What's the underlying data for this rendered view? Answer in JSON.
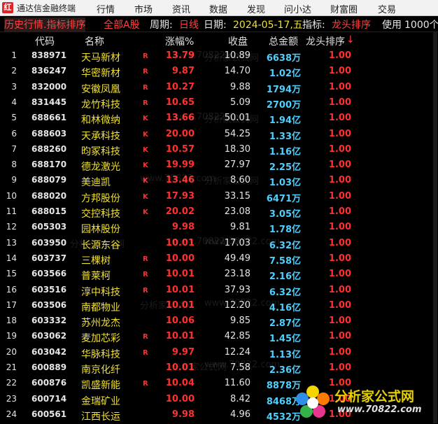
{
  "window": {
    "app_title": "通达信金融终端",
    "icon_glyph": "红"
  },
  "menus": [
    "行情",
    "市场",
    "资讯",
    "数据",
    "发现",
    "问小达",
    "财富圈",
    "交易"
  ],
  "infobar": {
    "part1": "历史行情.指标排序",
    "part2": "全部A股",
    "period_label": "周期:",
    "period_value": "日线",
    "date_label": "日期:",
    "date_value": "2024-05-17,五",
    "indicator_label": "指标:",
    "indicator_value": "龙头排序",
    "usage_label": "使用",
    "usage_value": "1000个"
  },
  "columns": {
    "code": "代码",
    "name": "名称",
    "pct": "涨幅%",
    "close": "收盘",
    "amount": "总金额",
    "rank": "龙头排序",
    "sort_arrow": "↓"
  },
  "colors": {
    "up": "#ff3030",
    "flat": "#e6e6e6",
    "name": "#f0e030",
    "amount": "#4ed0ff"
  },
  "rows": [
    {
      "idx": "1",
      "code": "838971",
      "name": "天马新材",
      "flag": "R",
      "pct": "13.79",
      "close": "10.89",
      "amount": "6638万",
      "rank": "1.00"
    },
    {
      "idx": "2",
      "code": "836247",
      "name": "华密新材",
      "flag": "R",
      "pct": "9.87",
      "close": "14.70",
      "amount": "1.02亿",
      "rank": "1.00"
    },
    {
      "idx": "3",
      "code": "832000",
      "name": "安徽凤凰",
      "flag": "R",
      "pct": "10.27",
      "close": "9.88",
      "amount": "1794万",
      "rank": "1.00"
    },
    {
      "idx": "4",
      "code": "831445",
      "name": "龙竹科技",
      "flag": "R",
      "pct": "10.65",
      "close": "5.09",
      "amount": "2700万",
      "rank": "1.00"
    },
    {
      "idx": "5",
      "code": "688661",
      "name": "和林微纳",
      "flag": "K",
      "pct": "13.66",
      "close": "50.01",
      "amount": "1.94亿",
      "rank": "1.00"
    },
    {
      "idx": "6",
      "code": "688603",
      "name": "天承科技",
      "flag": "K",
      "pct": "20.00",
      "close": "54.25",
      "amount": "1.33亿",
      "rank": "1.00"
    },
    {
      "idx": "7",
      "code": "688260",
      "name": "昀冢科技",
      "flag": "K",
      "pct": "10.57",
      "close": "18.30",
      "amount": "1.16亿",
      "rank": "1.00"
    },
    {
      "idx": "8",
      "code": "688170",
      "name": "德龙激光",
      "flag": "K",
      "pct": "19.99",
      "close": "27.97",
      "amount": "2.25亿",
      "rank": "1.00"
    },
    {
      "idx": "9",
      "code": "688079",
      "name": "美迪凯",
      "flag": "K",
      "pct": "13.46",
      "close": "8.60",
      "amount": "1.03亿",
      "rank": "1.00"
    },
    {
      "idx": "10",
      "code": "688020",
      "name": "方邦股份",
      "flag": "K",
      "pct": "17.93",
      "close": "33.15",
      "amount": "6471万",
      "rank": "1.00"
    },
    {
      "idx": "11",
      "code": "688015",
      "name": "交控科技",
      "flag": "K",
      "pct": "20.02",
      "close": "23.08",
      "amount": "3.05亿",
      "rank": "1.00"
    },
    {
      "idx": "12",
      "code": "605303",
      "name": "园林股份",
      "flag": "",
      "pct": "9.98",
      "close": "9.81",
      "amount": "1.78亿",
      "rank": "1.00"
    },
    {
      "idx": "13",
      "code": "603950",
      "name": "长源东谷",
      "flag": "",
      "pct": "10.01",
      "close": "17.03",
      "amount": "6.32亿",
      "rank": "1.00"
    },
    {
      "idx": "14",
      "code": "603737",
      "name": "三棵树",
      "flag": "R",
      "pct": "10.00",
      "close": "49.49",
      "amount": "7.58亿",
      "rank": "1.00"
    },
    {
      "idx": "15",
      "code": "603566",
      "name": "普莱柯",
      "flag": "R",
      "pct": "10.01",
      "close": "23.18",
      "amount": "2.16亿",
      "rank": "1.00"
    },
    {
      "idx": "16",
      "code": "603516",
      "name": "淳中科技",
      "flag": "R",
      "pct": "10.01",
      "close": "37.93",
      "amount": "6.32亿",
      "rank": "1.00"
    },
    {
      "idx": "17",
      "code": "603506",
      "name": "南都物业",
      "flag": "",
      "pct": "10.01",
      "close": "12.20",
      "amount": "4.16亿",
      "rank": "1.00"
    },
    {
      "idx": "18",
      "code": "603332",
      "name": "苏州龙杰",
      "flag": "",
      "pct": "10.06",
      "close": "9.85",
      "amount": "2.87亿",
      "rank": "1.00"
    },
    {
      "idx": "19",
      "code": "603062",
      "name": "麦加芯彩",
      "flag": "R",
      "pct": "10.01",
      "close": "42.85",
      "amount": "1.45亿",
      "rank": "1.00"
    },
    {
      "idx": "20",
      "code": "603042",
      "name": "华脉科技",
      "flag": "R",
      "pct": "9.97",
      "close": "12.24",
      "amount": "1.13亿",
      "rank": "1.00"
    },
    {
      "idx": "21",
      "code": "600889",
      "name": "南京化纤",
      "flag": "",
      "pct": "10.01",
      "close": "7.58",
      "amount": "2.36亿",
      "rank": "1.00"
    },
    {
      "idx": "22",
      "code": "600876",
      "name": "凯盛新能",
      "flag": "R",
      "pct": "10.04",
      "close": "11.60",
      "amount": "8878万",
      "rank": "1.00"
    },
    {
      "idx": "23",
      "code": "600714",
      "name": "金瑞矿业",
      "flag": "",
      "pct": "10.00",
      "close": "8.42",
      "amount": "8468万",
      "rank": "1.00"
    },
    {
      "idx": "24",
      "code": "600561",
      "name": "江西长运",
      "flag": "",
      "pct": "9.98",
      "close": "4.96",
      "amount": "4532万",
      "rank": "1.00"
    }
  ],
  "watermark": {
    "url": "www.70822.com",
    "brand": "分析家公式网"
  },
  "logo": {
    "brand": "分析家公式网",
    "url": "www.70822.com",
    "icon": "flower-logo-icon"
  }
}
